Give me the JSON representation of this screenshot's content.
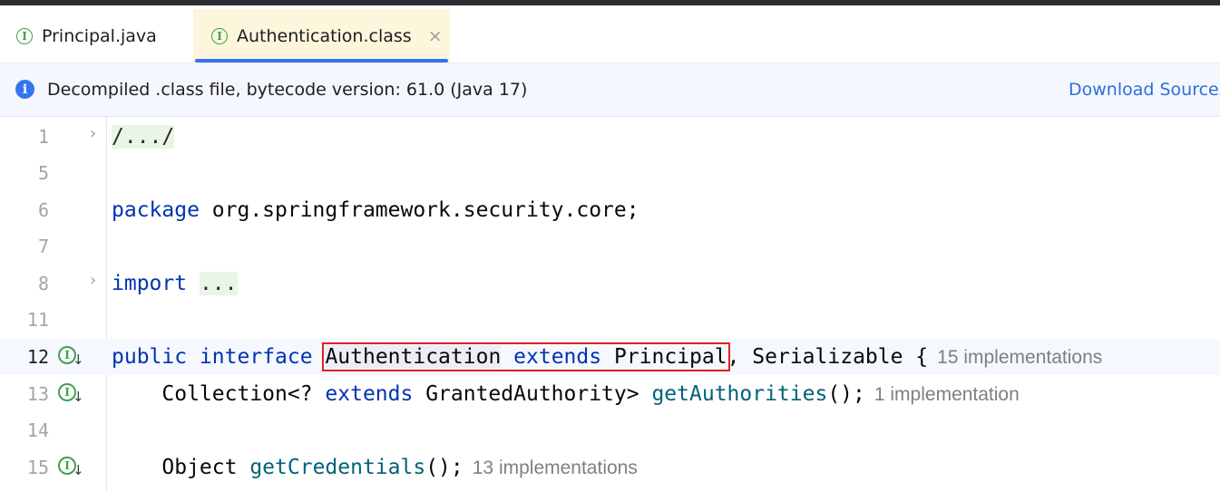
{
  "tabs": [
    {
      "label": "Principal.java",
      "icon": "interface-icon",
      "icon_glyph": "I",
      "active": false
    },
    {
      "label": "Authentication.class",
      "icon": "interface-icon",
      "icon_glyph": "I",
      "active": true,
      "close": "×"
    }
  ],
  "banner": {
    "icon": "info-icon",
    "icon_glyph": "i",
    "text": "Decompiled .class file, bytecode version: 61.0 (Java 17)",
    "action": "Download Sources"
  },
  "editor": {
    "gutter_icon_glyph": "I",
    "gutter_arrow": "↓",
    "fold_glyph": "›",
    "lines": {
      "l1": {
        "number": "1",
        "text": "/.../"
      },
      "l5": {
        "number": "5"
      },
      "l6": {
        "number": "6",
        "kw": "package",
        "rest": " org.springframework.security.core;"
      },
      "l7": {
        "number": "7"
      },
      "l8": {
        "number": "8",
        "kw": "import",
        "folded": "..."
      },
      "l11": {
        "number": "11"
      },
      "l12": {
        "number": "12",
        "kw1": "public",
        "kw2": "interface",
        "name": "Authentication",
        "kw3": "extends",
        "super1": "Principal",
        "rest": ", Serializable {",
        "hint": "15 implementations"
      },
      "l13": {
        "number": "13",
        "type1": "Collection<? ",
        "kw": "extends",
        "type2": " GrantedAuthority> ",
        "method": "getAuthorities",
        "tail": "();",
        "hint": "1 implementation"
      },
      "l14": {
        "number": "14"
      },
      "l15": {
        "number": "15",
        "type": "Object ",
        "method": "getCredentials",
        "tail": "();",
        "hint": "13 implementations"
      }
    }
  },
  "colors": {
    "keyword": "#0033b3",
    "method": "#00627a",
    "accent": "#3574f0",
    "interface_icon": "#3fa34d",
    "highlight_box": "#e02020"
  }
}
